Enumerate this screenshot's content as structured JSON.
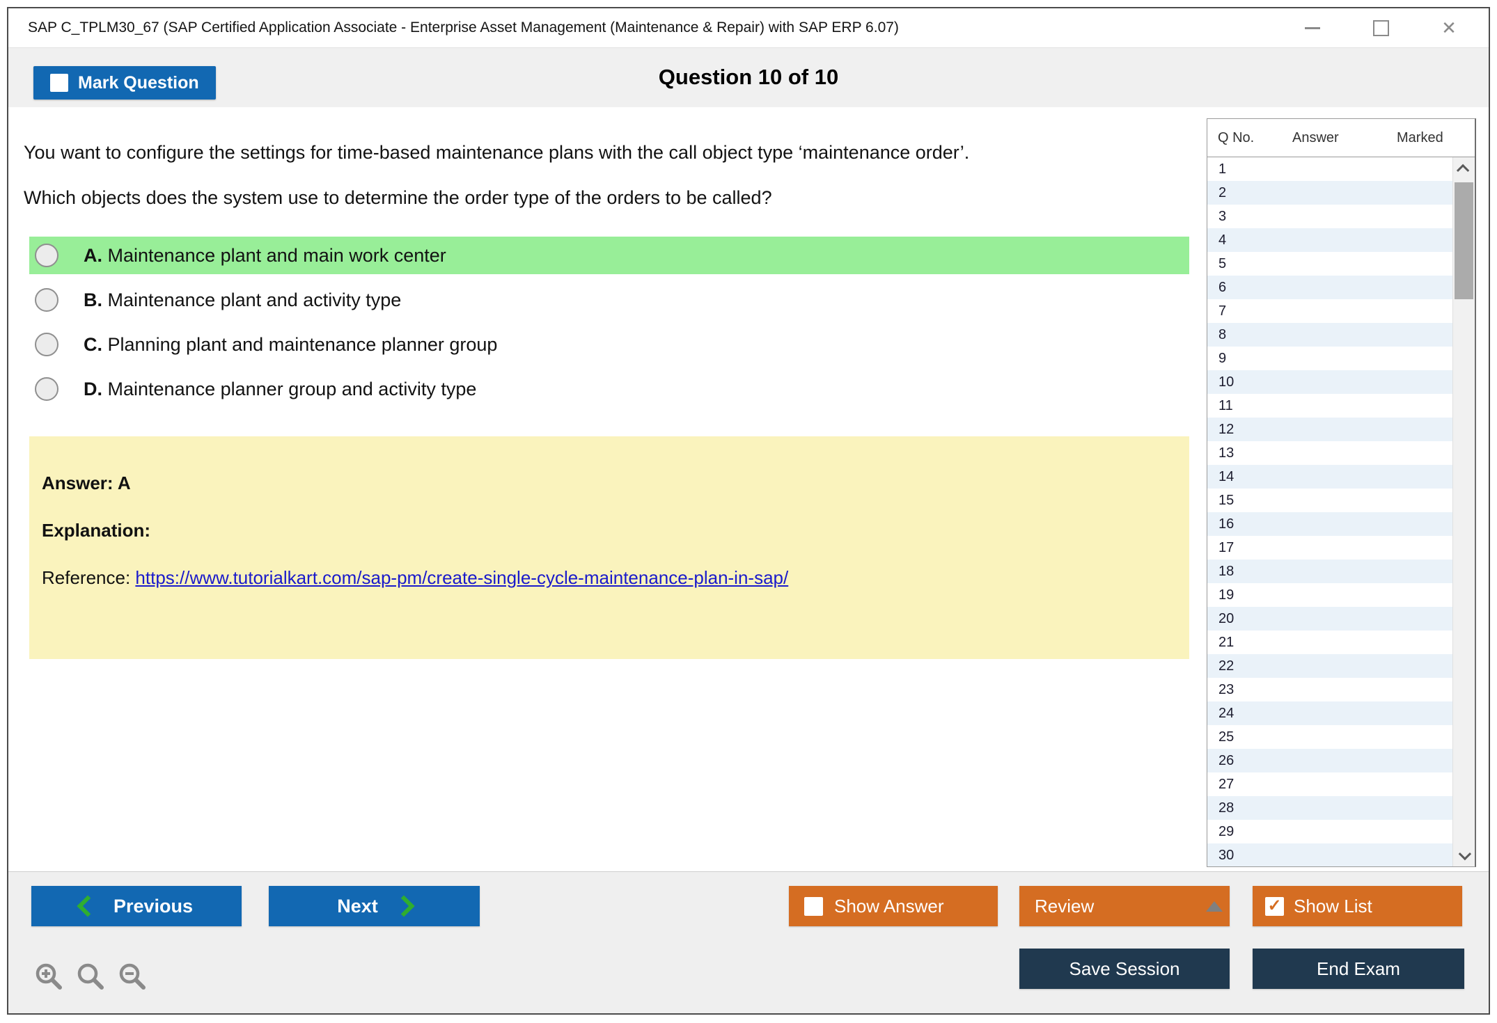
{
  "window": {
    "title": "SAP C_TPLM30_67 (SAP Certified Application Associate - Enterprise Asset Management (Maintenance & Repair) with SAP ERP 6.07)"
  },
  "header": {
    "mark_question_label": "Mark Question",
    "question_counter": "Question 10 of 10"
  },
  "question": {
    "line1": "You want to configure the settings for time-based maintenance plans with the call object type ‘maintenance order’.",
    "line2": "Which objects does the system use to determine the order type of the orders to be called?",
    "options": [
      {
        "letter": "A.",
        "text": "Maintenance plant and main work center",
        "highlighted": true
      },
      {
        "letter": "B.",
        "text": "Maintenance plant and activity type",
        "highlighted": false
      },
      {
        "letter": "C.",
        "text": "Planning plant and maintenance planner group",
        "highlighted": false
      },
      {
        "letter": "D.",
        "text": "Maintenance planner group and activity type",
        "highlighted": false
      }
    ]
  },
  "explanation_box": {
    "answer_label": "Answer: A",
    "explanation_label": "Explanation:",
    "reference_prefix": "Reference: ",
    "reference_link": "https://www.tutorialkart.com/sap-pm/create-single-cycle-maintenance-plan-in-sap/"
  },
  "question_list": {
    "columns": {
      "qno": "Q No.",
      "answer": "Answer",
      "marked": "Marked"
    },
    "rows": [
      "1",
      "2",
      "3",
      "4",
      "5",
      "6",
      "7",
      "8",
      "9",
      "10",
      "11",
      "12",
      "13",
      "14",
      "15",
      "16",
      "17",
      "18",
      "19",
      "20",
      "21",
      "22",
      "23",
      "24",
      "25",
      "26",
      "27",
      "28",
      "29",
      "30"
    ]
  },
  "footer": {
    "previous_label": "Previous",
    "next_label": "Next",
    "show_answer_label": "Show Answer",
    "review_label": "Review",
    "show_list_label": "Show List",
    "save_session_label": "Save Session",
    "end_exam_label": "End Exam"
  },
  "colors": {
    "blue": "#1268b2",
    "orange": "#d56d22",
    "navy": "#20394f",
    "green_highlight": "#98ee98",
    "yellow_box": "#faf3bd",
    "alt_row": "#eaf2f9",
    "link": "#1a1acb"
  }
}
